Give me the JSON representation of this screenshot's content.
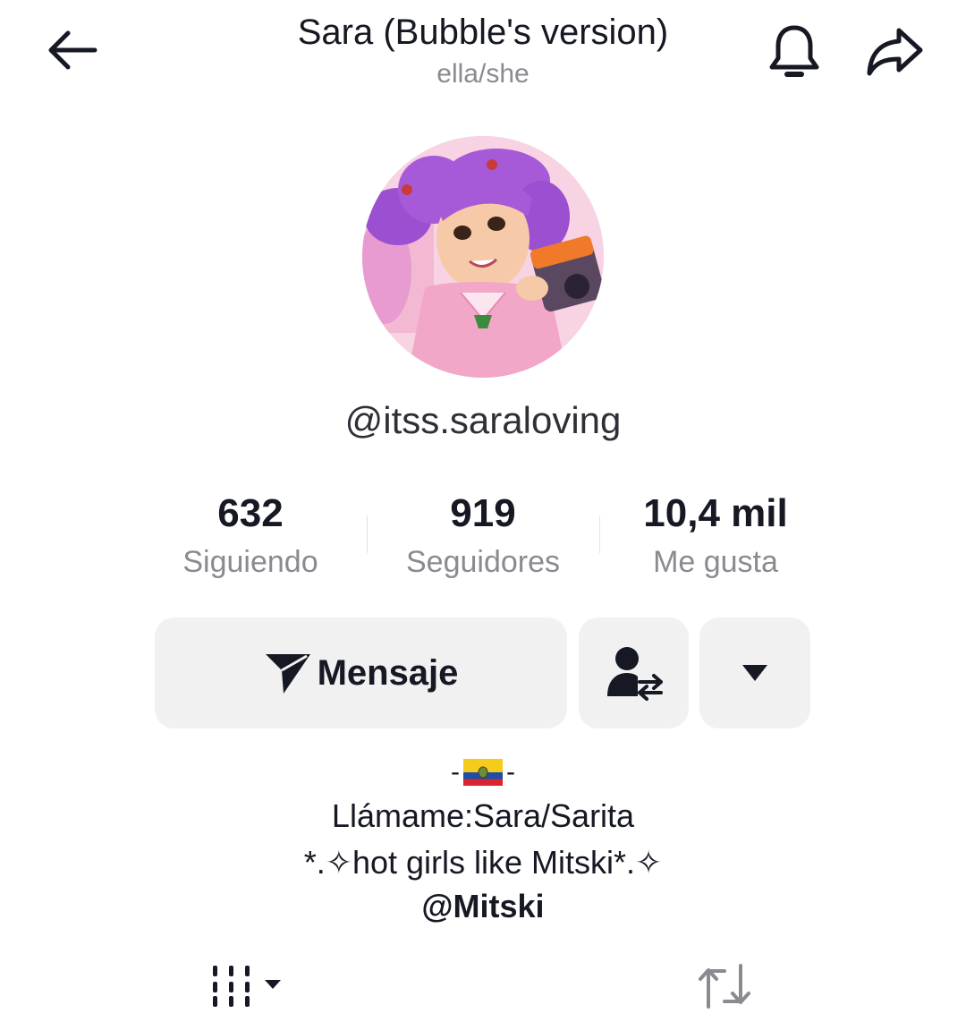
{
  "header": {
    "title": "Sara (Bubble's version)",
    "pronouns": "ella/she",
    "icons": [
      "arrow-left-icon",
      "bell-icon",
      "share-arrow-icon"
    ]
  },
  "profile": {
    "handle": "@itss.saraloving",
    "avatar": "avatar-illustration"
  },
  "stats": [
    {
      "value": "632",
      "label": "Siguiendo"
    },
    {
      "value": "919",
      "label": "Seguidores"
    },
    {
      "value": "10,4 mil",
      "label": "Me gusta"
    }
  ],
  "actions": {
    "message_label": "Mensaje",
    "message_icon": "paper-plane-icon",
    "follow_icon": "user-swap-icon",
    "more_icon": "caret-down-icon"
  },
  "bio": {
    "flag_prefix": "-",
    "flag_suffix": "-",
    "flag": "ecuador-flag",
    "line1": "Llámame:Sara/Sarita",
    "line2": "*.✧hot girls like Mitski*.✧",
    "mention": "@Mitski"
  },
  "tabs": {
    "grid_icon": "grid-icon",
    "repost_icon": "repost-icon"
  },
  "colors": {
    "text": "#161823",
    "muted": "#8a8b91",
    "button_bg": "#f1f1f2"
  }
}
